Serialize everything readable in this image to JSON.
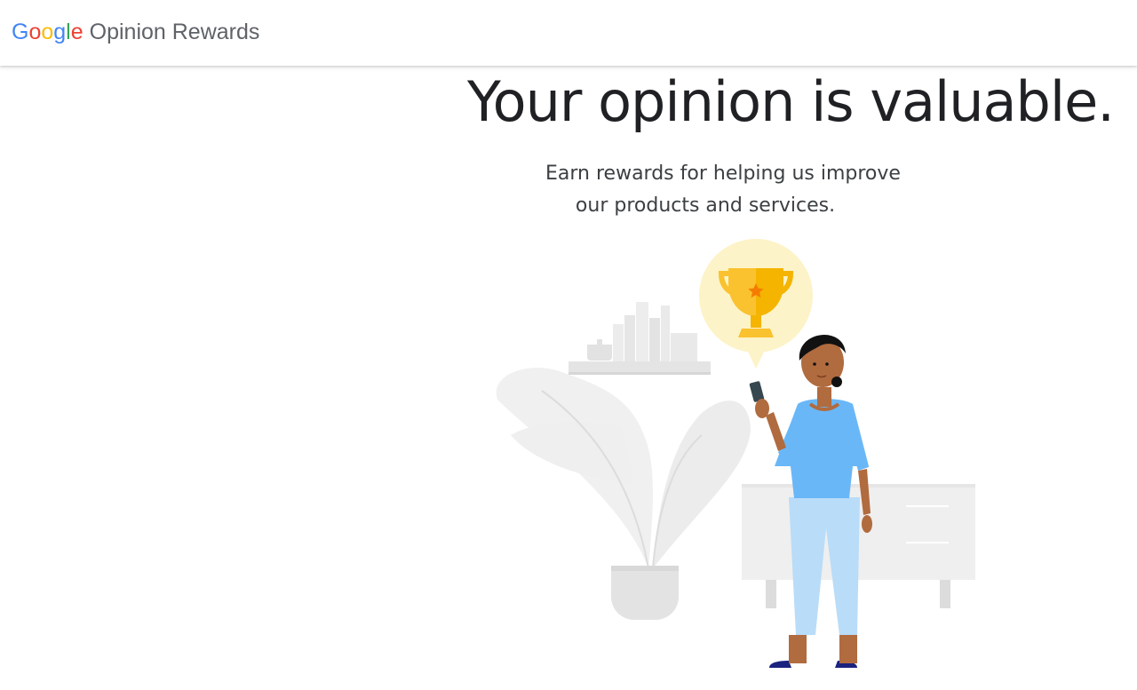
{
  "header": {
    "logo": {
      "letters": [
        "G",
        "o",
        "o",
        "g",
        "l",
        "e"
      ],
      "product_name": "Opinion Rewards"
    }
  },
  "hero": {
    "title": "Your opinion is valuable.",
    "subtitle_line1": "Earn rewards for helping us improve",
    "subtitle_line2": "our products and services."
  },
  "illustration": {
    "depicts": "woman-holding-phone-with-trophy-bubble"
  },
  "colors": {
    "google_blue": "#4285F4",
    "google_red": "#EA4335",
    "google_yellow": "#FBBC05",
    "google_green": "#34A853",
    "product_text": "#5f6368",
    "title_text": "#202124",
    "shirt_blue": "#6ab7f7",
    "pants_blue": "#b9dcf8",
    "trophy_gold": "#f9c22e",
    "bubble_yellow": "#fdf3c8"
  }
}
